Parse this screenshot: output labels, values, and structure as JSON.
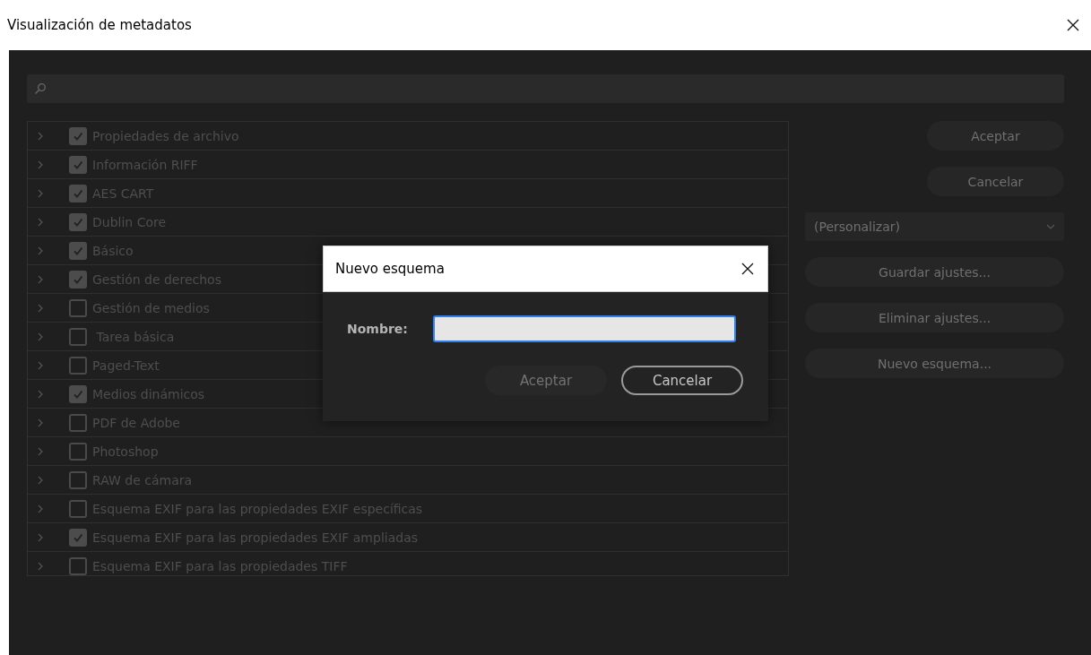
{
  "window": {
    "title": "Visualización de metadatos"
  },
  "schemas": [
    {
      "label": "Propiedades de archivo",
      "checked": true
    },
    {
      "label": "Información RIFF",
      "checked": true
    },
    {
      "label": "AES CART",
      "checked": true
    },
    {
      "label": "Dublin Core",
      "checked": true
    },
    {
      "label": "Básico",
      "checked": true
    },
    {
      "label": "Gestión de derechos",
      "checked": true
    },
    {
      "label": "Gestión de medios",
      "checked": false
    },
    {
      "label": " Tarea básica",
      "checked": false
    },
    {
      "label": "Paged-Text",
      "checked": false
    },
    {
      "label": "Medios dinámicos",
      "checked": true
    },
    {
      "label": "PDF de Adobe",
      "checked": false
    },
    {
      "label": "Photoshop",
      "checked": false
    },
    {
      "label": "RAW de cámara",
      "checked": false
    },
    {
      "label": "Esquema EXIF para las propiedades EXIF específicas",
      "checked": false
    },
    {
      "label": "Esquema EXIF para las propiedades EXIF ampliadas",
      "checked": true
    },
    {
      "label": "Esquema EXIF para las propiedades TIFF",
      "checked": false
    }
  ],
  "actions": {
    "ok": "Aceptar",
    "cancel": "Cancelar"
  },
  "preset": {
    "value": "(Personalizar)"
  },
  "preset_buttons": [
    "Guardar ajustes...",
    "Eliminar ajustes...",
    "Nuevo esquema..."
  ],
  "dialog": {
    "title": "Nuevo esquema",
    "field_label": "Nombre:",
    "buttons": [
      {
        "label": "Aceptar",
        "disabled": true
      },
      {
        "label": "Cancelar",
        "disabled": false
      }
    ]
  }
}
